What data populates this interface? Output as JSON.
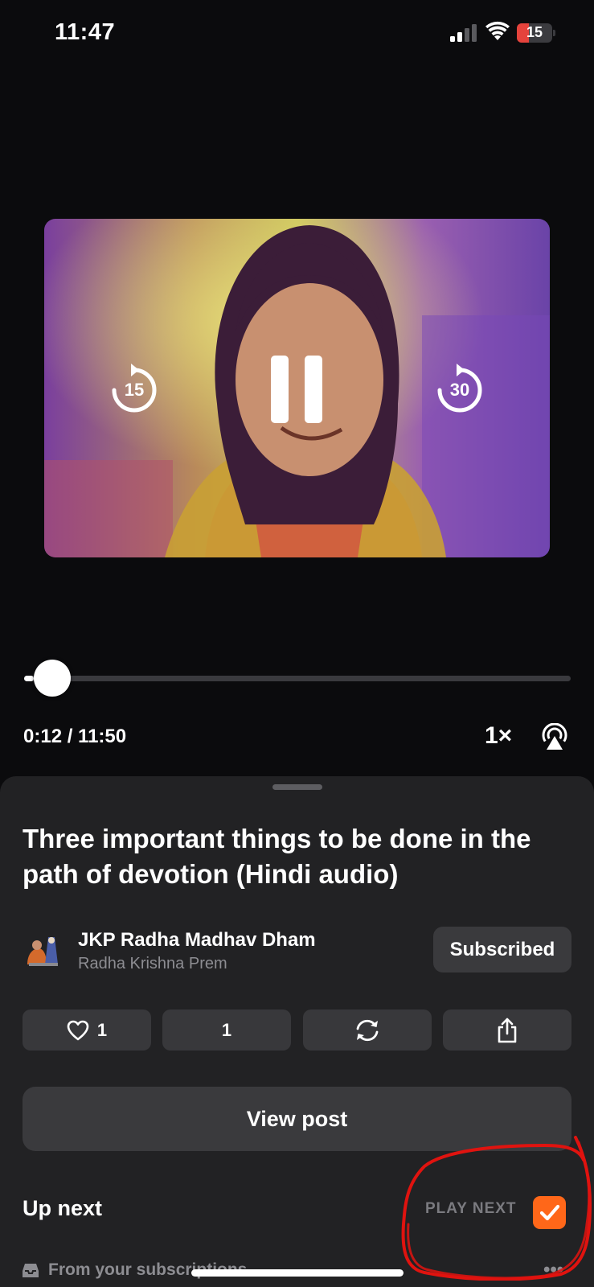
{
  "status_bar": {
    "time": "11:47",
    "battery_percent": "15",
    "battery_level": 0.15,
    "colors": {
      "battery_low": "#e5433c"
    },
    "icons": [
      "signal-icon",
      "wifi-icon",
      "battery-icon"
    ]
  },
  "player": {
    "skip_back_seconds": "15",
    "skip_forward_seconds": "30",
    "state": "playing",
    "elapsed": "0:12",
    "total": "11:50",
    "timecode": "0:12 / 11:50",
    "progress": 0.017,
    "speed": "1×",
    "icons": [
      "rewind-15-icon",
      "pause-icon",
      "forward-30-icon",
      "airplay-icon"
    ]
  },
  "episode": {
    "title": "Three important things to be done in the path of devotion (Hindi audio)"
  },
  "channel": {
    "name": "JKP Radha Madhav Dham",
    "author": "Radha Krishna Prem",
    "subscribe_label": "Subscribed"
  },
  "actions": {
    "likes": "1",
    "comments": "1",
    "icons": [
      "heart-icon",
      "restack-icon",
      "share-icon"
    ]
  },
  "view_post_label": "View post",
  "up_next": {
    "heading": "Up next",
    "play_next_label": "PLAY NEXT",
    "play_next_checked": true,
    "source_label": "From your subscriptions",
    "more_label": "•••",
    "colors": {
      "accent": "#ff6719",
      "annotation": "#e0130f"
    }
  }
}
